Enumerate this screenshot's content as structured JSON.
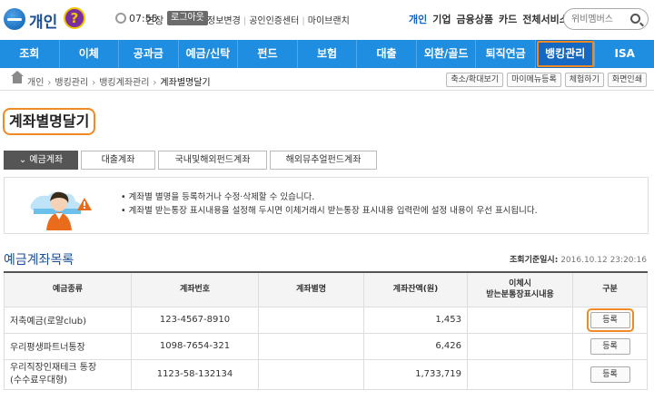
{
  "header": {
    "site_title": "개인",
    "help_icon_label": "?",
    "clock_icon": "clock-icon",
    "time": "07:55",
    "extend_label": "연장",
    "logout_label": "로그아웃",
    "links": [
      "정보변경",
      "공인인증센터",
      "마이브랜치"
    ],
    "right_nav": [
      "개인",
      "기업",
      "금융상품",
      "카드",
      "전체서비스 ▾"
    ],
    "search_placeholder": "위비멤버스",
    "search_icon": "search-icon"
  },
  "main_nav": {
    "items": [
      "조회",
      "이체",
      "공과금",
      "예금/신탁",
      "펀드",
      "보험",
      "대출",
      "외환/골드",
      "퇴직연금",
      "뱅킹관리",
      "ISA"
    ],
    "active": "뱅킹관리"
  },
  "breadcrumb": {
    "home_icon": "home-icon",
    "items": [
      "개인",
      "뱅킹관리",
      "뱅킹계좌관리",
      "계좌별명달기"
    ],
    "buttons": [
      "축소/확대보기",
      "마이메뉴등록",
      "체험하기",
      "화면인쇄"
    ]
  },
  "page": {
    "title": "계좌별명달기"
  },
  "tabs": {
    "items": [
      "예금계좌",
      "대출계좌",
      "국내및해외펀드계좌",
      "해외뮤추얼펀드계좌"
    ],
    "active": "예금계좌"
  },
  "notice": {
    "lines": [
      "계좌별 별명을 등록하거나 수정·삭제할 수 있습니다.",
      "계좌별 받는통장 표시내용을 설정해 두시면 이체거래시 받는통장 표시내용 입력란에 설정 내용이 우선 표시됩니다."
    ]
  },
  "section": {
    "title": "예금계좌목록",
    "query_label": "조회기준일시:",
    "query_value": "2016.10.12 23:20:16"
  },
  "table": {
    "headers": [
      "예금종류",
      "계좌번호",
      "계좌별명",
      "계좌잔액(원)",
      "이체시\n받는분통장표시내용",
      "구분"
    ],
    "rows": [
      {
        "type": "저축예금(로얄club)",
        "account": "123-4567-8910",
        "alias": "",
        "balance": "1,453",
        "display": "",
        "action": "등록"
      },
      {
        "type": "우리평생파트너통장",
        "account": "1098-7654-321",
        "alias": "",
        "balance": "6,426",
        "display": "",
        "action": "등록"
      },
      {
        "type": "우리직장인재테크 통장\n(수수료우대형)",
        "account": "1123-58-132134",
        "alias": "",
        "balance": "1,733,719",
        "display": "",
        "action": "등록"
      }
    ]
  },
  "colors": {
    "nav_blue": "#1f8ee0",
    "nav_active": "#1569c2",
    "highlight_orange": "#f08a24",
    "title_blue": "#1a4e95"
  }
}
